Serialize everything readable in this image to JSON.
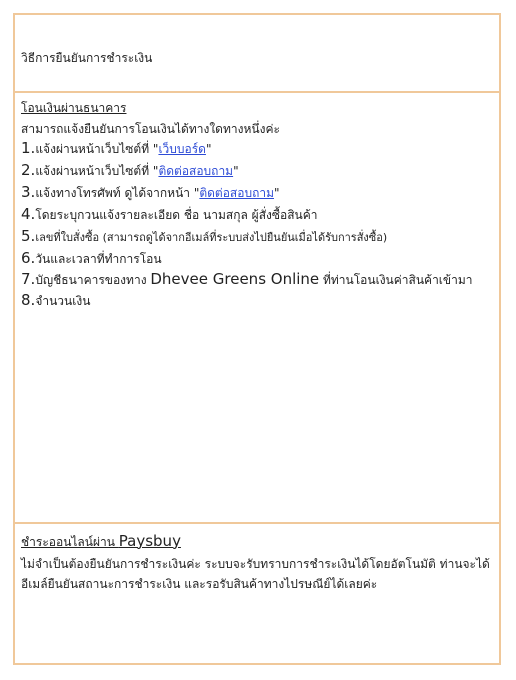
{
  "title": "วิธีการยืนยันการชำระเงิน",
  "bank": {
    "heading": "โอนเงินผ่านธนาคาร",
    "intro": "สามารถแจ้งยืนยันการโอนเงินได้ทางใดทางหนึ่งค่ะ",
    "items": [
      {
        "num": "1.",
        "text": "แจ้งผ่านหน้าเว็บไซต์ที่ \"",
        "link": "เว็บบอร์ด",
        "after": "\""
      },
      {
        "num": "2.",
        "text": "แจ้งผ่านหน้าเว็บไซต์ที่ \"",
        "link": "ติดต่อสอบถาม",
        "after": "\""
      },
      {
        "num": "3.",
        "text": "แจ้งทางโทรศัพท์ ดูได้จากหน้า \"",
        "link": "ติดต่อสอบถาม",
        "after": "\""
      },
      {
        "num": "4.",
        "text": "โดยระบุกวนแจ้งรายละเอียด ชื่อ นามสกุล ผู้สั่งซื้อสินค้า"
      },
      {
        "num": "5.",
        "text": "เลขที่ใบสั่งซื้อ (สามารถดูได้จากอีเมล์ที่ระบบส่งไปยืนยันเมื่อได้รับการสั่งซื้อ)"
      },
      {
        "num": "6.",
        "text": "วันและเวลาที่ทำการโอน"
      },
      {
        "num": "7.",
        "text": "บัญชีธนาคารของทาง ",
        "brand": "Dhevee Greens Online",
        "after": " ที่ท่านโอนเงินค่าสินค้าเข้ามา"
      },
      {
        "num": "8.",
        "text": "จำนวนเงิน"
      }
    ]
  },
  "paysbuy": {
    "heading": "ชำระออนไลน์ผ่าน ",
    "brand": "Paysbuy",
    "text": "ไม่จำเป็นต้องยืนยันการชำระเงินค่ะ ระบบจะรับทราบการชำระเงินได้โดยอัตโนมัติ ท่านจะได้อีเมล์ยืนยันสถานะการชำระเงิน และรอรับสินค้าทางไปรษณีย์ได้เลยค่ะ"
  }
}
